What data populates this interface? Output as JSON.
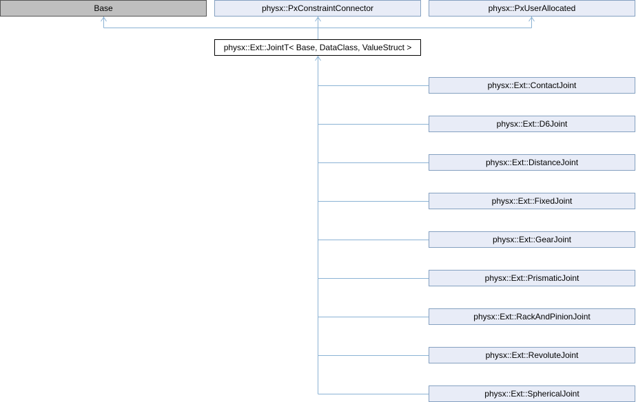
{
  "diagram": {
    "colors": {
      "edge": "#8ab2d4",
      "node_fill": "#e8ecf7",
      "node_border": "#84a0c0",
      "external_fill": "#bfbfbf",
      "current_fill": "#ffffff"
    },
    "base_classes": [
      {
        "label": "Base",
        "kind": "external"
      },
      {
        "label": "physx::PxConstraintConnector",
        "kind": "class"
      },
      {
        "label": "physx::PxUserAllocated",
        "kind": "class"
      }
    ],
    "current_class": {
      "label": "physx::Ext::JointT< Base, DataClass, ValueStruct >"
    },
    "derived_classes": [
      {
        "label": "physx::Ext::ContactJoint"
      },
      {
        "label": "physx::Ext::D6Joint"
      },
      {
        "label": "physx::Ext::DistanceJoint"
      },
      {
        "label": "physx::Ext::FixedJoint"
      },
      {
        "label": "physx::Ext::GearJoint"
      },
      {
        "label": "physx::Ext::PrismaticJoint"
      },
      {
        "label": "physx::Ext::RackAndPinionJoint"
      },
      {
        "label": "physx::Ext::RevoluteJoint"
      },
      {
        "label": "physx::Ext::SphericalJoint"
      }
    ]
  }
}
